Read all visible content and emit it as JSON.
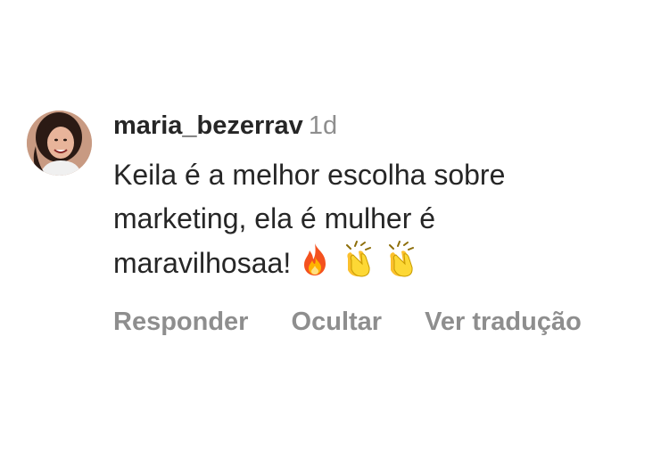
{
  "comment": {
    "username": "maria_bezerrav",
    "time": "1d",
    "text": "Keila é a melhor escolha sobre marketing, ela é mulher é maravilhosaa!",
    "emojis": [
      "fire-emoji",
      "clapping-hands-emoji",
      "clapping-hands-emoji"
    ],
    "actions": {
      "reply": "Responder",
      "hide": "Ocultar",
      "translate": "Ver tradução"
    }
  },
  "colors": {
    "primary_text": "#262626",
    "secondary_text": "#8e8e8e",
    "background": "#ffffff"
  }
}
